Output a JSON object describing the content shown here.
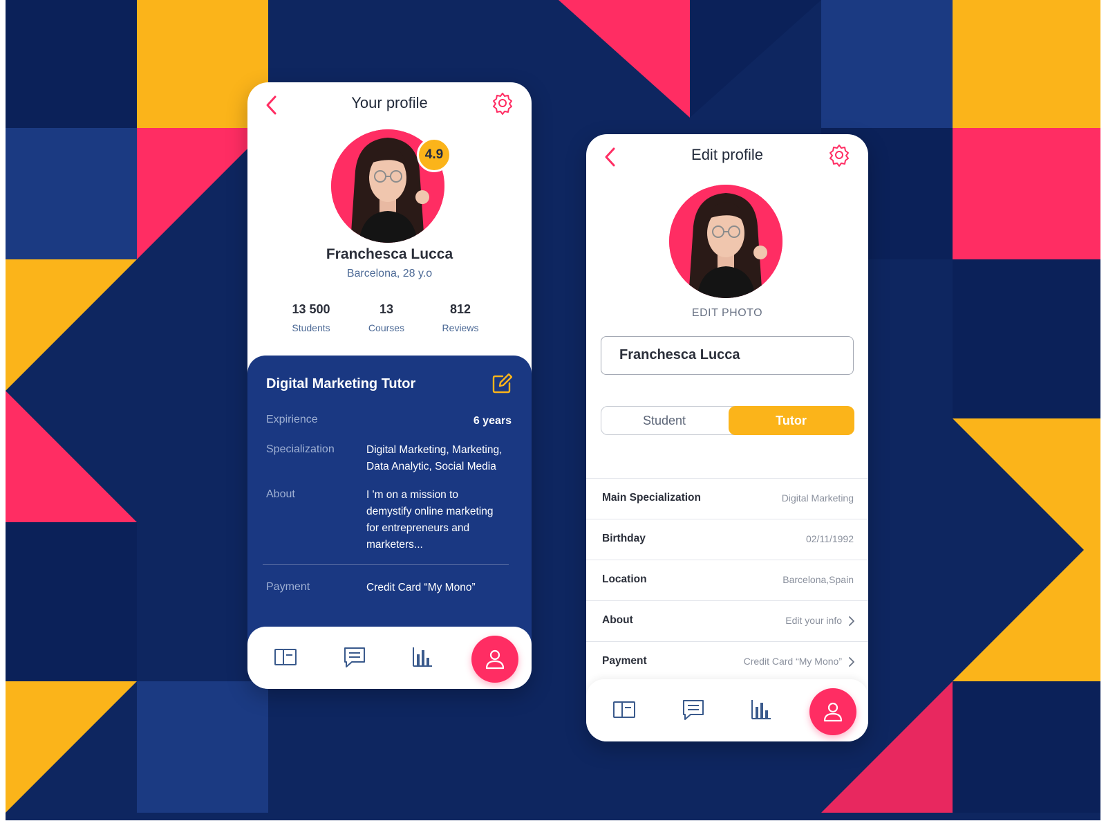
{
  "profile": {
    "title": "Your profile",
    "rating": "4.9",
    "name": "Franchesca Lucca",
    "location": "Barcelona, 28 y.o",
    "stats": [
      {
        "value": "13 500",
        "label": "Students"
      },
      {
        "value": "13",
        "label": "Courses"
      },
      {
        "value": "812",
        "label": "Reviews"
      }
    ],
    "role": "Digital Marketing Tutor",
    "details": {
      "experience_label": "Expirience",
      "experience_value": "6 years",
      "specialization_label": "Specialization",
      "specialization_value": "Digital Marketing, Marketing, Data Analytic, Social Media",
      "about_label": "About",
      "about_value": "I 'm on a mission to demystify online marketing for entrepreneurs and marketers...",
      "payment_label": "Payment",
      "payment_value": "Credit Card “My Mono”"
    }
  },
  "edit": {
    "title": "Edit profile",
    "edit_photo": "EDIT PHOTO",
    "name_value": "Franchesca Lucca",
    "role_options": [
      "Student",
      "Tutor"
    ],
    "selected_role": "Tutor",
    "fields": [
      {
        "label": "Main Specialization",
        "value": "Digital Marketing"
      },
      {
        "label": "Birthday",
        "value": "02/11/1992"
      },
      {
        "label": "Location",
        "value": "Barcelona,Spain"
      },
      {
        "label": "About",
        "value": "Edit your info"
      },
      {
        "label": "Payment",
        "value": "Credit Card “My Mono”"
      }
    ]
  },
  "nav_items": [
    "book-icon",
    "chat-icon",
    "chart-icon",
    "user-icon"
  ],
  "colors": {
    "pink": "#ff2d63",
    "yellow": "#fbb41a",
    "navy": "#0e2660",
    "panel_blue": "#1a3882"
  }
}
